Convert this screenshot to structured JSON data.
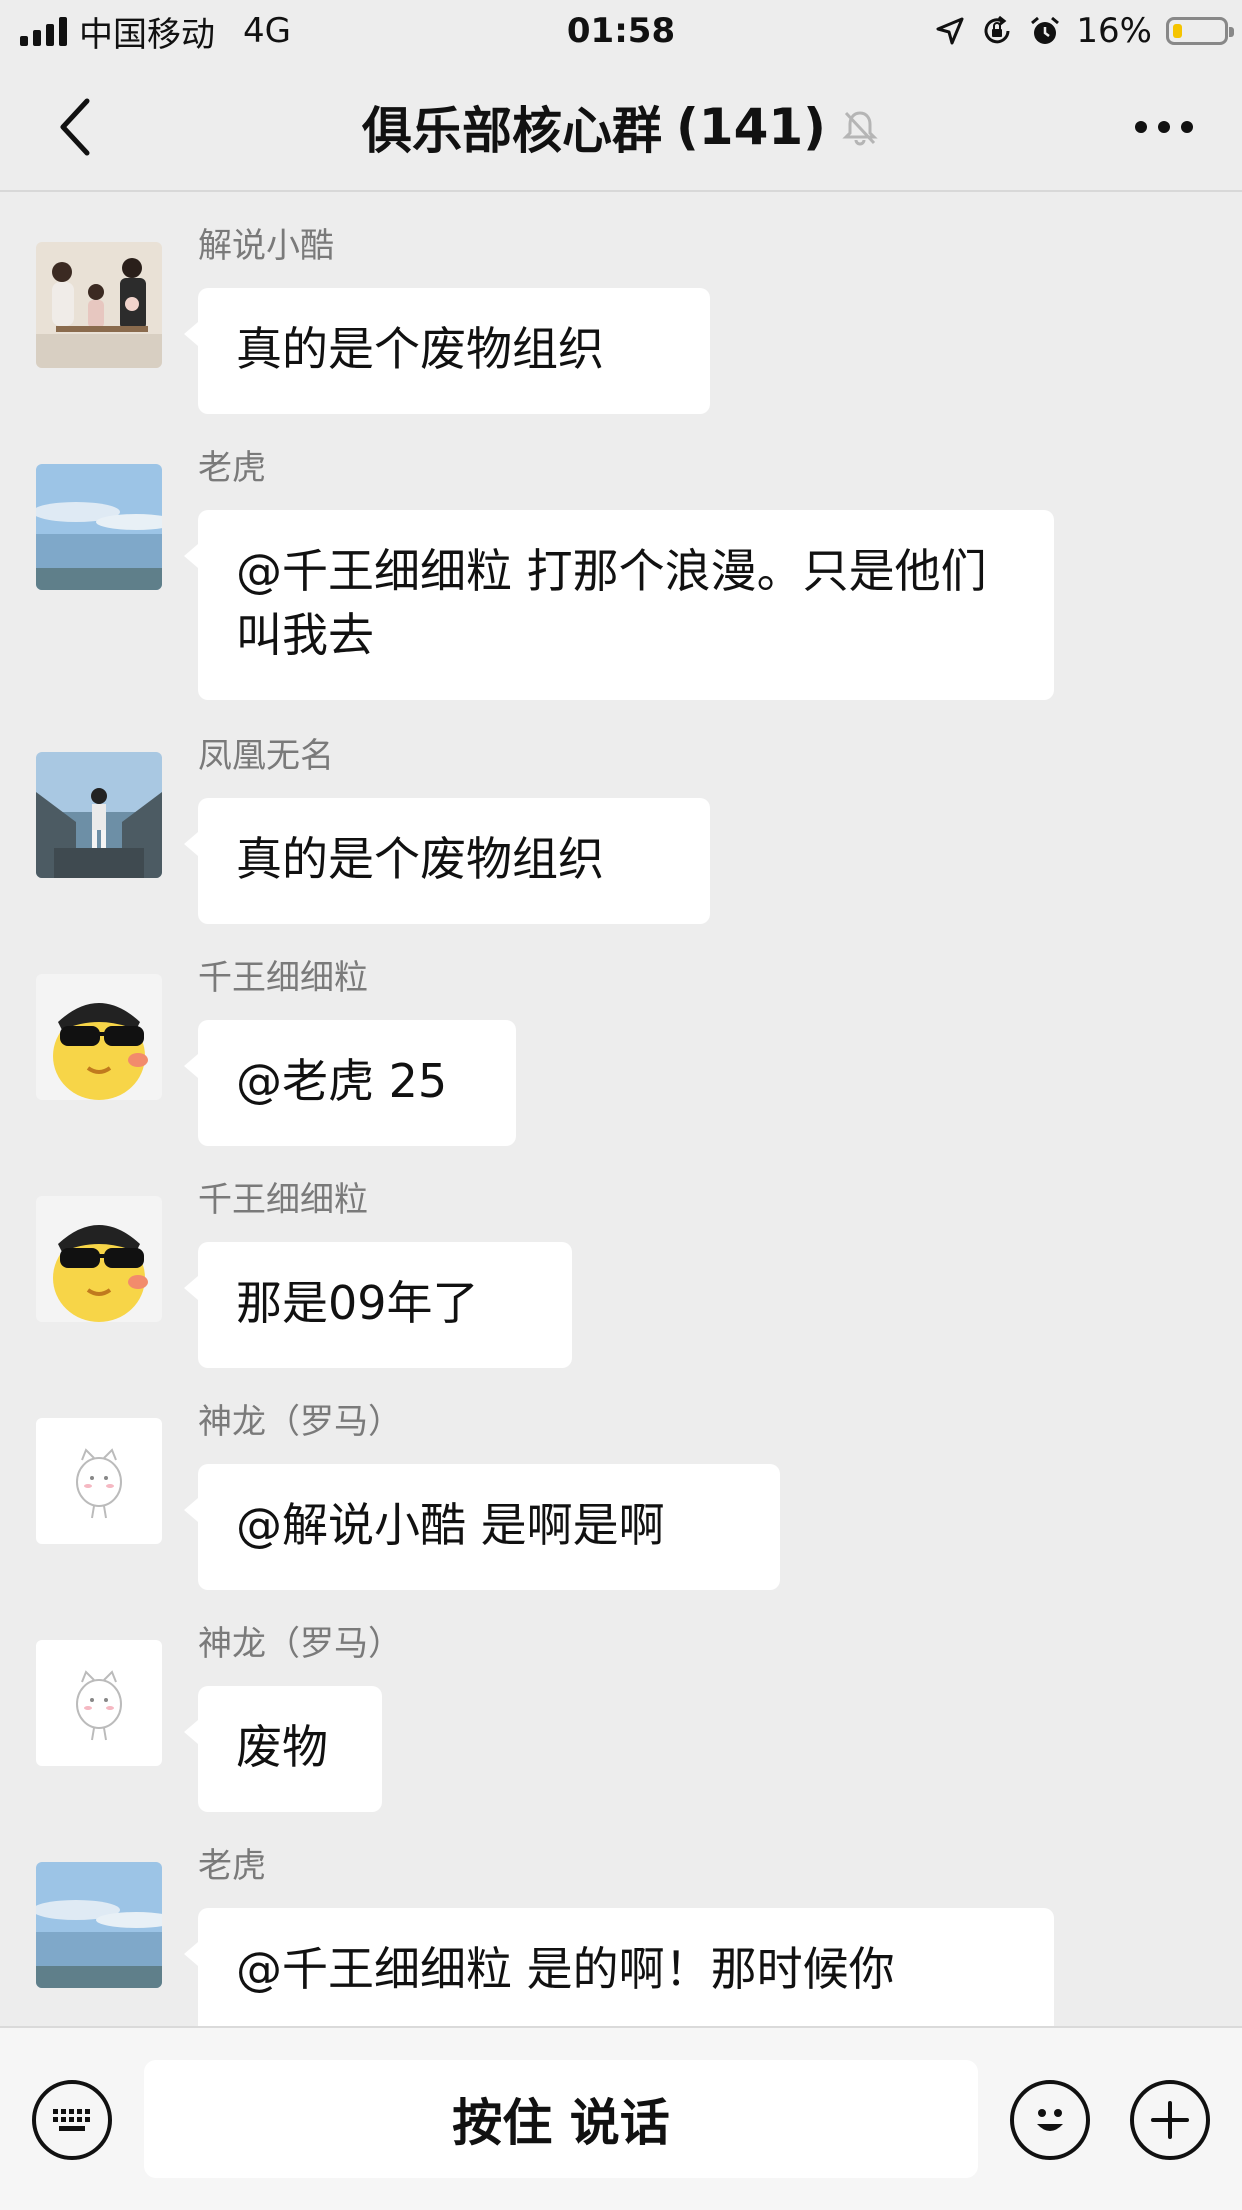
{
  "status_bar": {
    "carrier": "中国移动",
    "network": "4G",
    "time": "01:58",
    "battery_percent": "16%",
    "battery_level": 0.16
  },
  "header": {
    "title": "俱乐部核心群",
    "member_count": "(141)"
  },
  "messages": [
    {
      "sender": "解说小酷",
      "avatar": "family-photo-avatar",
      "text": "真的是个废物组织"
    },
    {
      "sender": "老虎",
      "avatar": "sea-landscape-avatar",
      "text": "@千王细细粒 打那个浪漫。只是他们叫我去"
    },
    {
      "sender": "凤凰无名",
      "avatar": "child-on-bridge-avatar",
      "text": "真的是个废物组织"
    },
    {
      "sender": "千王细细粒",
      "avatar": "cool-duck-avatar",
      "text": "@老虎 25"
    },
    {
      "sender": "千王细细粒",
      "avatar": "cool-duck-avatar",
      "text": "那是09年了"
    },
    {
      "sender": "神龙（罗马）",
      "avatar": "cartoon-cat-avatar",
      "text": "@解说小酷 是啊是啊"
    },
    {
      "sender": "神龙（罗马）",
      "avatar": "cartoon-cat-avatar",
      "text": "废物"
    },
    {
      "sender": "老虎",
      "avatar": "sea-landscape-avatar",
      "text": "@千王细细粒 是的啊！那时候你"
    }
  ],
  "input_bar": {
    "voice_label": "按住 说话"
  },
  "colors": {
    "background": "#ededed",
    "bubble": "#ffffff",
    "sender_text": "#7a7a7a",
    "battery_fill": "#f5c400"
  }
}
